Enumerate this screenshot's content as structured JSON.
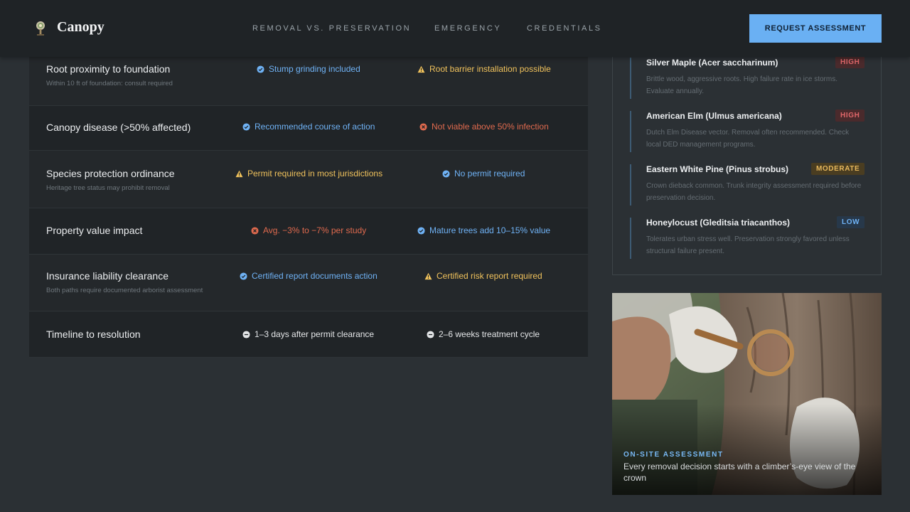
{
  "header": {
    "brand": "Canopy",
    "nav": [
      "REMOVAL VS. PRESERVATION",
      "EMERGENCY",
      "CREDENTIALS"
    ],
    "cta": "REQUEST ASSESSMENT"
  },
  "table": {
    "rows": [
      {
        "title": "Root proximity to foundation",
        "note": "Within 10 ft of foundation: consult required",
        "removal": {
          "icon": "check-icon",
          "text": "Stump grinding included",
          "color": "#6fb2f5"
        },
        "preservation": {
          "icon": "warning-icon",
          "text": "Root barrier installation possible",
          "color": "#f0c25c"
        }
      },
      {
        "title": "Canopy disease (>50% affected)",
        "note": "",
        "removal": {
          "icon": "check-icon",
          "text": "Recommended course of action",
          "color": "#6fb2f5"
        },
        "preservation": {
          "icon": "cross-icon",
          "text": "Not viable above 50% infection",
          "color": "#e06a4e"
        }
      },
      {
        "title": "Species protection ordinance",
        "note": "Heritage tree status may prohibit removal",
        "removal": {
          "icon": "warning-icon",
          "text": "Permit required in most jurisdictions",
          "color": "#f0c25c"
        },
        "preservation": {
          "icon": "check-icon",
          "text": "No permit required",
          "color": "#6fb2f5"
        }
      },
      {
        "title": "Property value impact",
        "note": "",
        "removal": {
          "icon": "cross-icon",
          "text": "Avg. −3% to −7% per study",
          "color": "#e06a4e"
        },
        "preservation": {
          "icon": "check-icon",
          "text": "Mature trees add 10–15% value",
          "color": "#6fb2f5"
        }
      },
      {
        "title": "Insurance liability clearance",
        "note": "Both paths require documented arborist assessment",
        "removal": {
          "icon": "check-icon",
          "text": "Certified report documents action",
          "color": "#6fb2f5"
        },
        "preservation": {
          "icon": "warning-icon",
          "text": "Certified risk report required",
          "color": "#f0c25c"
        }
      },
      {
        "title": "Timeline to resolution",
        "note": "",
        "removal": {
          "icon": "clock-icon",
          "text": "1–3 days after permit clearance",
          "color": "#e4e6e8"
        },
        "preservation": {
          "icon": "clock-icon",
          "text": "2–6 weeks treatment cycle",
          "color": "#e4e6e8"
        }
      }
    ]
  },
  "species": [
    {
      "name": "Silver Maple (Acer saccharinum)",
      "risk": "HIGH",
      "desc": "Brittle wood, aggressive roots. High failure rate in ice storms. Evaluate annually."
    },
    {
      "name": "American Elm (Ulmus americana)",
      "risk": "HIGH",
      "desc": "Dutch Elm Disease vector. Removal often recommended. Check local DED management programs."
    },
    {
      "name": "Eastern White Pine (Pinus strobus)",
      "risk": "MODERATE",
      "desc": "Crown dieback common. Trunk integrity assessment required before preservation decision."
    },
    {
      "name": "Honeylocust (Gleditsia triacanthos)",
      "risk": "LOW",
      "desc": "Tolerates urban stress well. Preservation strongly favored unless structural failure present."
    }
  ],
  "photo": {
    "kicker": "ON-SITE ASSESSMENT",
    "caption": "Every removal decision starts with a climber’s-eye view of the crown"
  },
  "colors": {
    "accent": "#6ab0f3",
    "high": "#e0676a",
    "moderate": "#e6b75c",
    "low": "#6fb2f5"
  }
}
